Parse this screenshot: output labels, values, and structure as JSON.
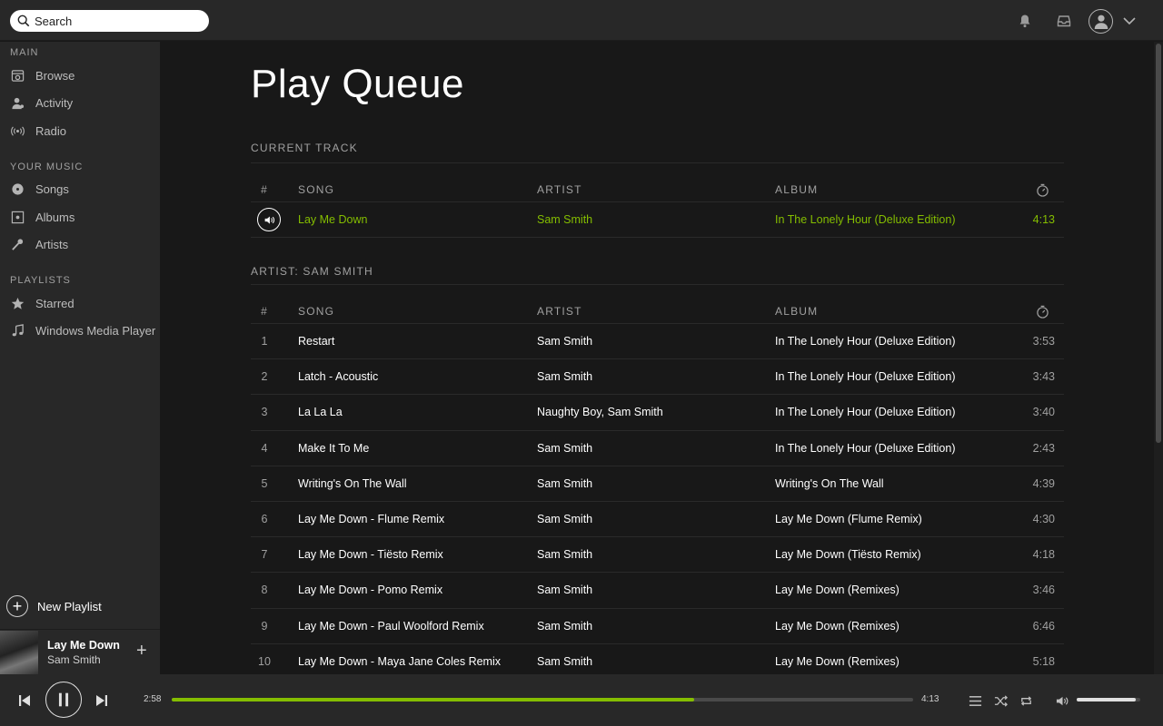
{
  "search": {
    "placeholder": "Search"
  },
  "topbar": {
    "icons": [
      "bell-icon",
      "inbox-icon",
      "user-avatar-icon",
      "chevron-down-icon"
    ]
  },
  "sidebar": {
    "main_title": "MAIN",
    "main_items": [
      {
        "label": "Browse",
        "icon": "browse-icon"
      },
      {
        "label": "Activity",
        "icon": "activity-icon"
      },
      {
        "label": "Radio",
        "icon": "radio-icon"
      }
    ],
    "music_title": "YOUR MUSIC",
    "music_items": [
      {
        "label": "Songs",
        "icon": "songs-icon"
      },
      {
        "label": "Albums",
        "icon": "albums-icon"
      },
      {
        "label": "Artists",
        "icon": "artists-icon"
      }
    ],
    "playlists_title": "PLAYLISTS",
    "playlist_items": [
      {
        "label": "Starred",
        "icon": "star-icon"
      },
      {
        "label": "Windows Media Player",
        "icon": "music-note-icon"
      }
    ],
    "new_playlist": "New Playlist",
    "now_playing": {
      "title": "Lay Me Down",
      "artist": "Sam Smith",
      "add": "+"
    }
  },
  "main": {
    "title": "Play Queue",
    "current_section": "CURRENT TRACK",
    "artist_section": "ARTIST: SAM SMITH",
    "columns": {
      "num": "#",
      "song": "SONG",
      "artist": "ARTIST",
      "album": "ALBUM"
    },
    "current_track": {
      "song": "Lay Me Down",
      "artist": "Sam Smith",
      "album": "In The Lonely Hour (Deluxe Edition)",
      "time": "4:13"
    },
    "queue": [
      {
        "num": "1",
        "song": "Restart",
        "artist": "Sam Smith",
        "album": "In The Lonely Hour (Deluxe Edition)",
        "time": "3:53"
      },
      {
        "num": "2",
        "song": "Latch - Acoustic",
        "artist": "Sam Smith",
        "album": "In The Lonely Hour (Deluxe Edition)",
        "time": "3:43"
      },
      {
        "num": "3",
        "song": "La La La",
        "artist": "Naughty Boy, Sam Smith",
        "album": "In The Lonely Hour (Deluxe Edition)",
        "time": "3:40"
      },
      {
        "num": "4",
        "song": "Make It To Me",
        "artist": "Sam Smith",
        "album": "In The Lonely Hour (Deluxe Edition)",
        "time": "2:43"
      },
      {
        "num": "5",
        "song": "Writing's On The Wall",
        "artist": "Sam Smith",
        "album": "Writing's On The Wall",
        "time": "4:39"
      },
      {
        "num": "6",
        "song": "Lay Me Down - Flume Remix",
        "artist": "Sam Smith",
        "album": "Lay Me Down (Flume Remix)",
        "time": "4:30"
      },
      {
        "num": "7",
        "song": "Lay Me Down - Tiësto Remix",
        "artist": "Sam Smith",
        "album": "Lay Me Down (Tiësto Remix)",
        "time": "4:18"
      },
      {
        "num": "8",
        "song": "Lay Me Down - Pomo Remix",
        "artist": "Sam Smith",
        "album": "Lay Me Down (Remixes)",
        "time": "3:46"
      },
      {
        "num": "9",
        "song": "Lay Me Down - Paul Woolford Remix",
        "artist": "Sam Smith",
        "album": "Lay Me Down (Remixes)",
        "time": "6:46"
      },
      {
        "num": "10",
        "song": "Lay Me Down - Maya Jane Coles Remix",
        "artist": "Sam Smith",
        "album": "Lay Me Down (Remixes)",
        "time": "5:18"
      }
    ]
  },
  "player": {
    "elapsed": "2:58",
    "duration": "4:13",
    "progress_fraction": 0.705,
    "volume_fraction": 0.93
  },
  "colors": {
    "accent": "#84bd00",
    "sidebar_bg": "#282828",
    "main_bg": "#181818"
  }
}
